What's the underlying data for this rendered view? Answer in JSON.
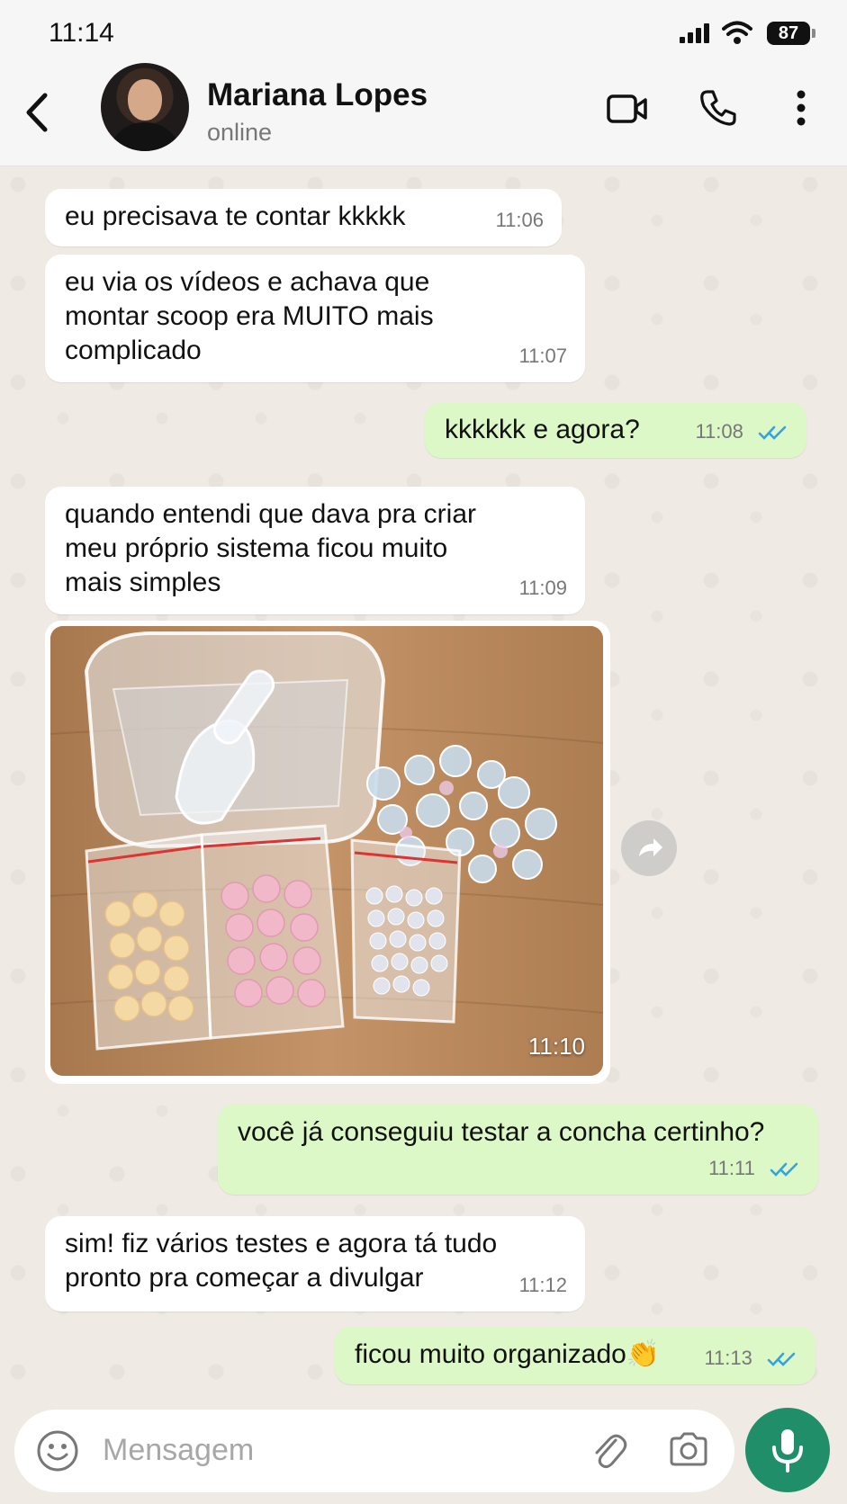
{
  "status_bar": {
    "time": "11:14",
    "battery": "87"
  },
  "header": {
    "contact_name": "Mariana Lopes",
    "presence": "online"
  },
  "messages": [
    {
      "direction": "in",
      "text": "eu precisava te contar kkkkk",
      "time": "11:06"
    },
    {
      "direction": "in",
      "text": "eu via os vídeos e achava que\nmontar scoop era MUITO mais\ncomplicado",
      "time": "11:07"
    },
    {
      "direction": "out",
      "text": "kkkkkk e agora?",
      "time": "11:08",
      "status": "read"
    },
    {
      "direction": "in",
      "text": "quando entendi que dava pra criar\nmeu próprio sistema ficou muito\nmais simples",
      "time": "11:09"
    },
    {
      "direction": "in",
      "type": "image",
      "time": "11:10"
    },
    {
      "direction": "out",
      "text": "você já conseguiu testar a concha certinho?",
      "time": "11:11",
      "status": "read"
    },
    {
      "direction": "in",
      "text": "sim! fiz vários testes e agora tá tudo\npronto pra começar a divulgar",
      "time": "11:12"
    },
    {
      "direction": "out",
      "text": "ficou muito organizado👏",
      "time": "11:13",
      "status": "read"
    }
  ],
  "composer": {
    "placeholder": "Mensagem"
  },
  "colors": {
    "incoming": "#ffffff",
    "outgoing": "#dcf8c6",
    "read_ticks": "#34a3e3",
    "accent": "#1f8e69"
  }
}
